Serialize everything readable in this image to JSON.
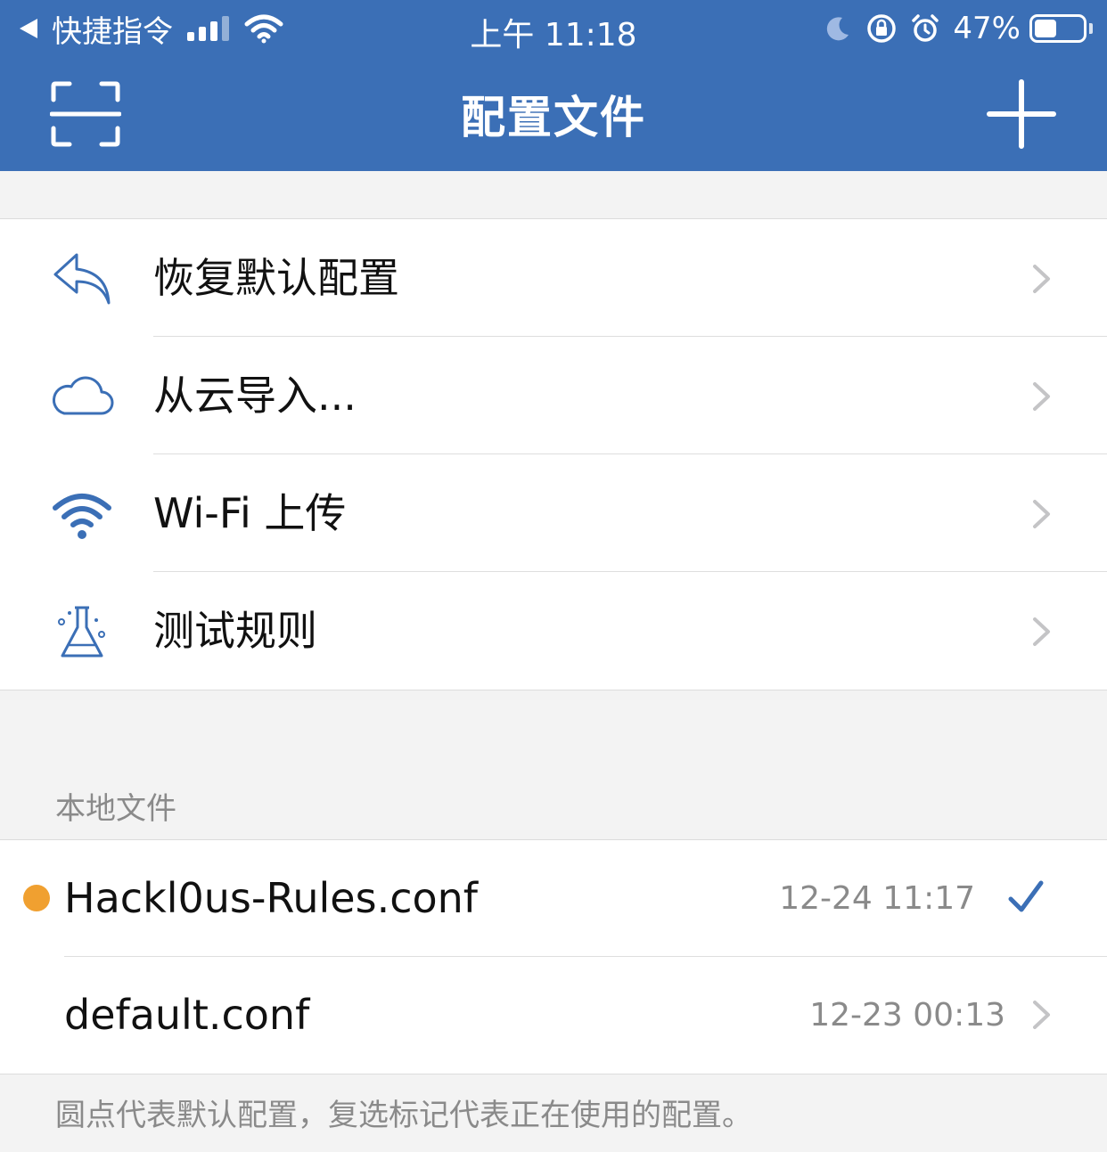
{
  "status_bar": {
    "back_app": "快捷指令",
    "time": "上午 11:18",
    "battery": "47%",
    "battery_level": 0.47
  },
  "nav": {
    "title": "配置文件"
  },
  "actions": [
    {
      "label": "恢复默认配置",
      "icon": "reply-arrow-icon"
    },
    {
      "label": "从云导入...",
      "icon": "cloud-icon"
    },
    {
      "label": "Wi-Fi 上传",
      "icon": "wifi-icon"
    },
    {
      "label": "测试规则",
      "icon": "flask-icon"
    }
  ],
  "local_files": {
    "header": "本地文件",
    "files": [
      {
        "name": "Hackl0us-Rules.conf",
        "date": "12-24 11:17",
        "default": true,
        "in_use": true
      },
      {
        "name": "default.conf",
        "date": "12-23 00:13",
        "default": false,
        "in_use": false
      }
    ],
    "note": "圆点代表默认配置，复选标记代表正在使用的配置。"
  },
  "colors": {
    "accent": "#3b6fb6",
    "default_dot": "#f0a030",
    "background": "#f3f3f3"
  }
}
